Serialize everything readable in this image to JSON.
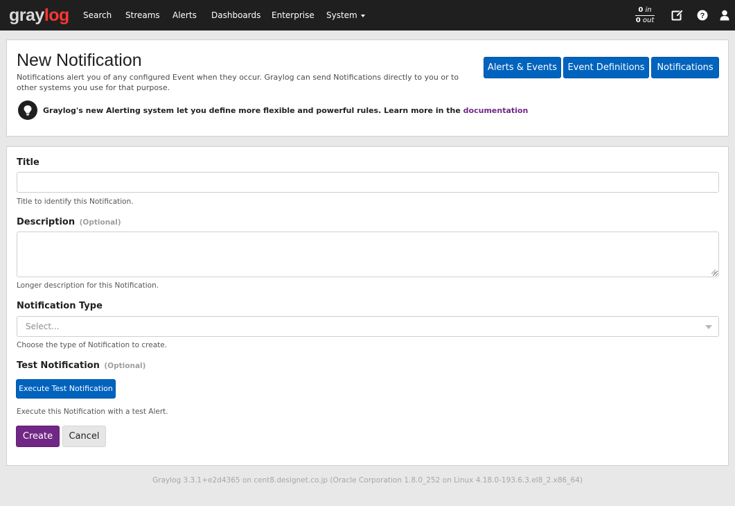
{
  "navbar": {
    "logo_gray": "gray",
    "logo_red": "log",
    "items": [
      {
        "label": "Search"
      },
      {
        "label": "Streams"
      },
      {
        "label": "Alerts"
      },
      {
        "label": "Dashboards"
      },
      {
        "label": "Enterprise"
      },
      {
        "label": "System"
      }
    ],
    "throughput": {
      "in_value": "0",
      "in_unit": "in",
      "out_value": "0",
      "out_unit": "out"
    },
    "icons": [
      "edit-icon",
      "help-icon",
      "user-icon"
    ]
  },
  "header": {
    "title": "New Notification",
    "description": "Notifications alert you of any configured Event when they occur. Graylog can send Notifications directly to you or to other systems you use for that purpose.",
    "hint_text": "Graylog's new Alerting system let you define more flexible and powerful rules. Learn more in the",
    "hint_link": "documentation",
    "buttons": {
      "alerts_events": "Alerts & Events",
      "event_definitions": "Event Definitions",
      "notifications": "Notifications"
    }
  },
  "form": {
    "title_label": "Title",
    "title_value": "",
    "title_help": "Title to identify this Notification.",
    "description_label": "Description",
    "description_optional": "(Optional)",
    "description_value": "",
    "description_help": "Longer description for this Notification.",
    "type_label": "Notification Type",
    "type_placeholder": "Select...",
    "type_help": "Choose the type of Notification to create.",
    "test_label": "Test Notification",
    "test_optional": "(Optional)",
    "test_button": "Execute Test Notification",
    "test_help": "Execute this Notification with a test Alert.",
    "create_button": "Create",
    "cancel_button": "Cancel"
  },
  "footer": {
    "text": "Graylog 3.3.1+e2d4365 on cent8.designet.co.jp (Oracle Corporation 1.8.0_252 on Linux 4.18.0-193.6.3.el8_2.x86_64)"
  },
  "colors": {
    "navbar_bg": "#1f1f1f",
    "primary_blue": "#0063be",
    "purple": "#702785",
    "logo_red": "#ff3633"
  }
}
